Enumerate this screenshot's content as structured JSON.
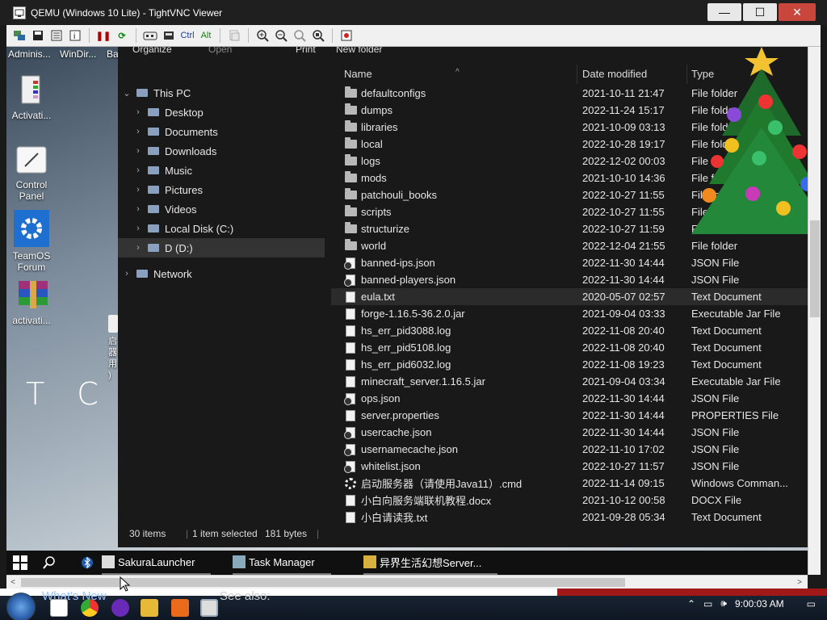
{
  "vnc": {
    "title": "QEMU (Windows 10 Lite) - TightVNC Viewer",
    "toolbar": {
      "ctrl": "Ctrl",
      "alt": "Alt"
    }
  },
  "desktop": {
    "top_labels": [
      "Adminis...",
      "WinDir...",
      "Ba"
    ],
    "icons": [
      {
        "label": "Activati...",
        "icon": "document-icon"
      },
      {
        "label": "Control Panel",
        "icon": "control-panel-icon"
      },
      {
        "label": "TeamOS Forum",
        "icon": "gear-icon"
      },
      {
        "label": "activati...",
        "icon": "winrar-icon"
      }
    ],
    "vertical_label": "启\n器\n用\n)",
    "tc_text": "T C &"
  },
  "explorer": {
    "cmdbar": [
      "Organize",
      "Open",
      "Print",
      "New folder"
    ],
    "nav": [
      {
        "label": "This PC",
        "icon": "computer-icon",
        "level": 0
      },
      {
        "label": "Desktop",
        "icon": "desktop-icon",
        "level": 1
      },
      {
        "label": "Documents",
        "icon": "documents-icon",
        "level": 1
      },
      {
        "label": "Downloads",
        "icon": "download-icon",
        "level": 1
      },
      {
        "label": "Music",
        "icon": "music-icon",
        "level": 1
      },
      {
        "label": "Pictures",
        "icon": "pictures-icon",
        "level": 1
      },
      {
        "label": "Videos",
        "icon": "videos-icon",
        "level": 1
      },
      {
        "label": "Local Disk (C:)",
        "icon": "drive-icon",
        "level": 1
      },
      {
        "label": "D (D:)",
        "icon": "drive-icon",
        "level": 1,
        "selected": true
      },
      {
        "label": "Network",
        "icon": "network-icon",
        "level": 0
      }
    ],
    "columns": {
      "name": "Name",
      "date": "Date modified",
      "type": "Type"
    },
    "files": [
      {
        "name": "defaultconfigs",
        "date": "2021-10-11 21:47",
        "type": "File folder",
        "kind": "folder"
      },
      {
        "name": "dumps",
        "date": "2022-11-24 15:17",
        "type": "File folder",
        "kind": "folder"
      },
      {
        "name": "libraries",
        "date": "2021-10-09 03:13",
        "type": "File folder",
        "kind": "folder"
      },
      {
        "name": "local",
        "date": "2022-10-28 19:17",
        "type": "File folder",
        "kind": "folder"
      },
      {
        "name": "logs",
        "date": "2022-12-02 00:03",
        "type": "File folder",
        "kind": "folder"
      },
      {
        "name": "mods",
        "date": "2021-10-10 14:36",
        "type": "File folder",
        "kind": "folder"
      },
      {
        "name": "patchouli_books",
        "date": "2022-10-27 11:55",
        "type": "File folder",
        "kind": "folder"
      },
      {
        "name": "scripts",
        "date": "2022-10-27 11:55",
        "type": "File folder",
        "kind": "folder"
      },
      {
        "name": "structurize",
        "date": "2022-10-27 11:59",
        "type": "File folder",
        "kind": "folder"
      },
      {
        "name": "world",
        "date": "2022-12-04 21:55",
        "type": "File folder",
        "kind": "folder"
      },
      {
        "name": "banned-ips.json",
        "date": "2022-11-30 14:44",
        "type": "JSON File",
        "kind": "json"
      },
      {
        "name": "banned-players.json",
        "date": "2022-11-30 14:44",
        "type": "JSON File",
        "kind": "json"
      },
      {
        "name": "eula.txt",
        "date": "2020-05-07 02:57",
        "type": "Text Document",
        "kind": "doc",
        "selected": true
      },
      {
        "name": "forge-1.16.5-36.2.0.jar",
        "date": "2021-09-04 03:33",
        "type": "Executable Jar File",
        "kind": "doc"
      },
      {
        "name": "hs_err_pid3088.log",
        "date": "2022-11-08 20:40",
        "type": "Text Document",
        "kind": "doc"
      },
      {
        "name": "hs_err_pid5108.log",
        "date": "2022-11-08 20:40",
        "type": "Text Document",
        "kind": "doc"
      },
      {
        "name": "hs_err_pid6032.log",
        "date": "2022-11-08 19:23",
        "type": "Text Document",
        "kind": "doc"
      },
      {
        "name": "minecraft_server.1.16.5.jar",
        "date": "2021-09-04 03:34",
        "type": "Executable Jar File",
        "kind": "doc"
      },
      {
        "name": "ops.json",
        "date": "2022-11-30 14:44",
        "type": "JSON File",
        "kind": "json"
      },
      {
        "name": "server.properties",
        "date": "2022-11-30 14:44",
        "type": "PROPERTIES File",
        "kind": "doc"
      },
      {
        "name": "usercache.json",
        "date": "2022-11-30 14:44",
        "type": "JSON File",
        "kind": "json"
      },
      {
        "name": "usernamecache.json",
        "date": "2022-11-10 17:02",
        "type": "JSON File",
        "kind": "json"
      },
      {
        "name": "whitelist.json",
        "date": "2022-10-27 11:57",
        "type": "JSON File",
        "kind": "json"
      },
      {
        "name": "启动服务器（请使用Java11）.cmd",
        "date": "2022-11-14 09:15",
        "type": "Windows Comman...",
        "kind": "gear"
      },
      {
        "name": "小白向服务端联机教程.docx",
        "date": "2021-10-12 00:58",
        "type": "DOCX File",
        "kind": "doc"
      },
      {
        "name": "小白请读我.txt",
        "date": "2021-09-28 05:34",
        "type": "Text Document",
        "kind": "doc"
      }
    ],
    "status": {
      "count": "30 items",
      "selected": "1 item selected",
      "size": "181 bytes"
    }
  },
  "taskbar": {
    "apps": [
      {
        "label": "SakuraLauncher",
        "icon": "sakura-icon"
      },
      {
        "label": "Task Manager",
        "icon": "task-manager-icon"
      },
      {
        "label": "异界生活幻想Server...",
        "icon": "folder-icon"
      }
    ]
  },
  "host": {
    "peek_left": "What's New",
    "peek_right": "See also:",
    "clock": "9:00:03 AM"
  }
}
